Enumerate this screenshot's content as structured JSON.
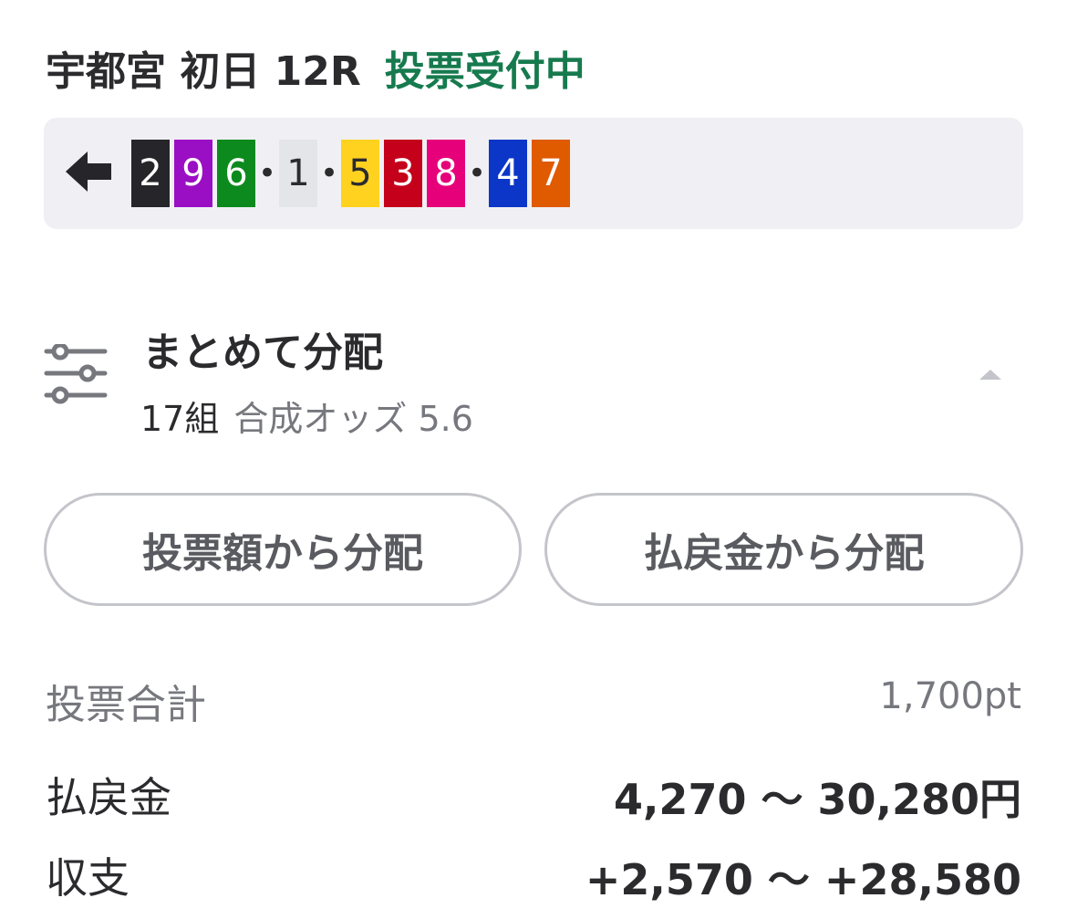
{
  "header": {
    "race": "宇都宮 初日 12R",
    "status": "投票受付中"
  },
  "lineup": {
    "back_icon": "arrow-left-icon",
    "items": [
      {
        "kind": "chip",
        "num": "2",
        "bg": "#26262a",
        "fg": "#ffffff"
      },
      {
        "kind": "chip",
        "num": "9",
        "bg": "#9b0fc4",
        "fg": "#ffffff"
      },
      {
        "kind": "chip",
        "num": "6",
        "bg": "#0d8a1e",
        "fg": "#ffffff"
      },
      {
        "kind": "sep",
        "text": "•"
      },
      {
        "kind": "chip",
        "num": "1",
        "bg": "#e4e5e9",
        "fg": "#2b2b2e"
      },
      {
        "kind": "sep",
        "text": "•"
      },
      {
        "kind": "chip",
        "num": "5",
        "bg": "#ffd21f",
        "fg": "#2b2b2e"
      },
      {
        "kind": "chip",
        "num": "3",
        "bg": "#c4001a",
        "fg": "#ffffff"
      },
      {
        "kind": "chip",
        "num": "8",
        "bg": "#e6007a",
        "fg": "#ffffff"
      },
      {
        "kind": "sep",
        "text": "•"
      },
      {
        "kind": "chip",
        "num": "4",
        "bg": "#0b36c8",
        "fg": "#ffffff"
      },
      {
        "kind": "chip",
        "num": "7",
        "bg": "#e05a00",
        "fg": "#ffffff"
      }
    ]
  },
  "distribution": {
    "icon": "sliders-icon",
    "title": "まとめて分配",
    "count": "17組",
    "odds": "合成オッズ 5.6",
    "toggle_icon": "caret-up-icon"
  },
  "buttons": {
    "by_amount": "投票額から分配",
    "by_payout": "払戻金から分配"
  },
  "summary": {
    "total_label": "投票合計",
    "total_value": "1,700pt",
    "payout_label": "払戻金",
    "payout_value": "4,270 〜 30,280円",
    "balance_label": "収支",
    "balance_value": "+2,570 〜 +28,580"
  },
  "colors": {
    "status_green": "#167a4e",
    "lineup_bg": "#f0f0f4",
    "pill_border": "#c4c5ca"
  }
}
